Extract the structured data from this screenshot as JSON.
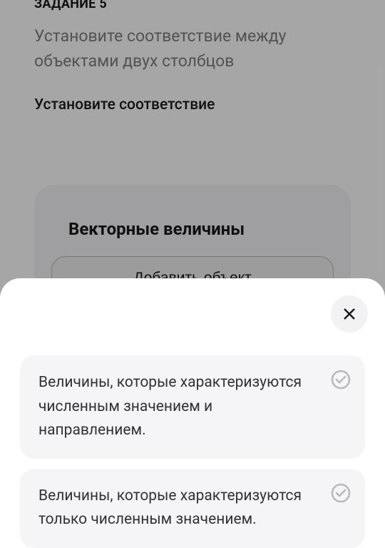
{
  "task": {
    "header": "ЗАДАНИЕ 5",
    "description": "Установите соответствие между объектами двух столбцов",
    "subtitle": "Установите соответствие"
  },
  "card": {
    "title": "Векторные величины",
    "addButton": "Добавить объект"
  },
  "sheet": {
    "options": [
      {
        "text": "Величины, которые характеризуются численным значением и направлением."
      },
      {
        "text": "Величины, которые характеризуются только численным значением."
      }
    ]
  }
}
